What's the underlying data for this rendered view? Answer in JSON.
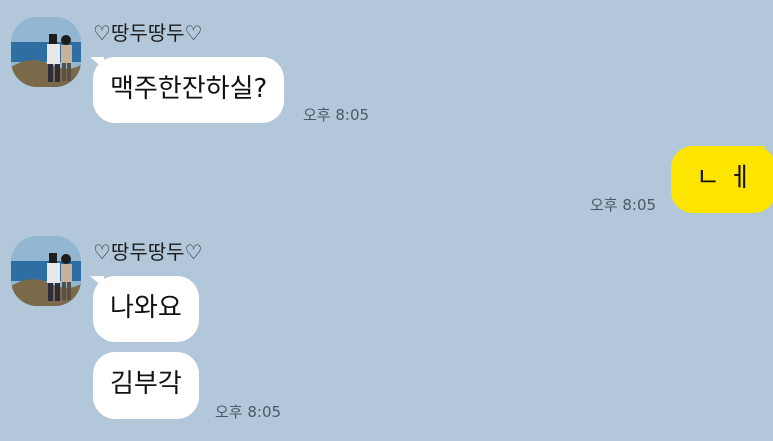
{
  "messages": [
    {
      "sender": "♡땅두땅두♡",
      "bubbles": [
        "맥주한잔하실?"
      ],
      "time": "오후 8:05"
    },
    {
      "outgoing": true,
      "bubbles": [
        "ㄴ ㅔ"
      ],
      "time": "오후 8:05"
    },
    {
      "sender": "♡땅두땅두♡",
      "bubbles": [
        "나와요",
        "김부각"
      ],
      "time": "오후 8:05"
    }
  ],
  "colors": {
    "background": "#b2c7da",
    "incoming_bubble": "#ffffff",
    "outgoing_bubble": "#fee500"
  },
  "icons": {
    "avatar": "profile-photo-avatar"
  }
}
